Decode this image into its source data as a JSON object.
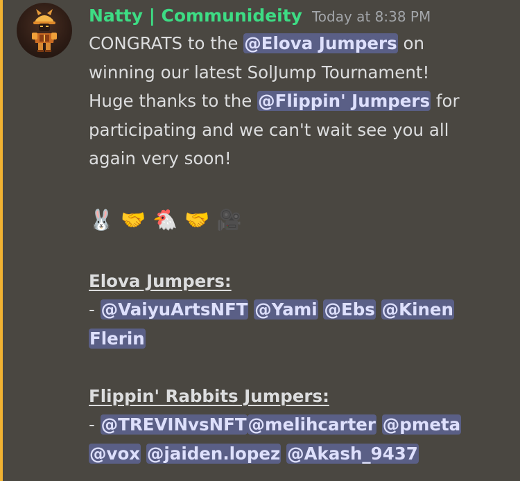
{
  "message": {
    "author": "Natty | Communideity",
    "timestamp": "Today at 8:38 PM",
    "line1_a": "CONGRATS to the ",
    "mention_team1": "@Elova Jumpers",
    "line1_b": " on",
    "line2": "winning our latest SolJump Tournament!",
    "line3_a": "Huge thanks to the ",
    "mention_team2": "@Flippin' Jumpers",
    "line3_b": " for",
    "line4": "participating and we can't wait see you all",
    "line5": "again very soon!",
    "emojis": [
      "🐰",
      "🤝",
      "🐔",
      "🤝",
      "🎥"
    ],
    "section1_title": "Elova Jumpers:",
    "section1_members": [
      "@VaiyuArtsNFT",
      "@Yami",
      "@Ebs",
      "@Kinen",
      "Flerin"
    ],
    "section2_title": "Flippin' Rabbits Jumpers:",
    "section2_members": [
      "@TREVINvsNFT",
      "@melihcarter",
      "@pmeta",
      "@vox",
      "@jaiden.lopez",
      "@Akash_9437"
    ],
    "dash": "- "
  },
  "colors": {
    "background": "#4a4741",
    "accent_bar": "#f0b232",
    "username": "#3ddc84",
    "timestamp": "#a3a6aa",
    "text": "#dcddde",
    "mention_bg": "#5a5f86",
    "mention_text": "#dee0fc"
  }
}
